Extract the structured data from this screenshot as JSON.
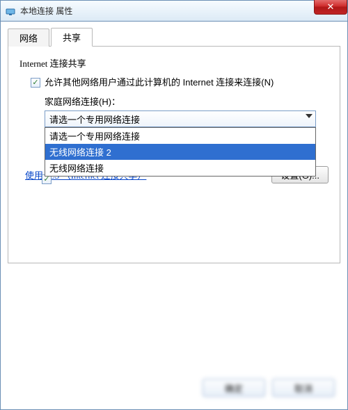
{
  "window": {
    "title": "本地连接 属性",
    "close_glyph": "✕"
  },
  "tabs": {
    "network": "网络",
    "sharing": "共享",
    "active": "sharing"
  },
  "group": {
    "title": "Internet 连接共享"
  },
  "checkbox1": {
    "checked": true,
    "label": "允许其他网络用户通过此计算机的 Internet 连接来连接(N)"
  },
  "homeconn": {
    "label": "家庭网络连接(H)：",
    "selected": "请选一个专用网络连接",
    "options": [
      {
        "text": "请选一个专用网络连接",
        "highlight": false
      },
      {
        "text": "无线网络连接 2",
        "highlight": true
      },
      {
        "text": "无线网络连接",
        "highlight": false
      }
    ]
  },
  "checkbox2": {
    "checked": true,
    "label": ""
  },
  "link": {
    "text": "使用 ICS （Internet 连接共享）"
  },
  "buttons": {
    "settings": "设置(G)...",
    "ok": "确定",
    "cancel": "取消"
  }
}
